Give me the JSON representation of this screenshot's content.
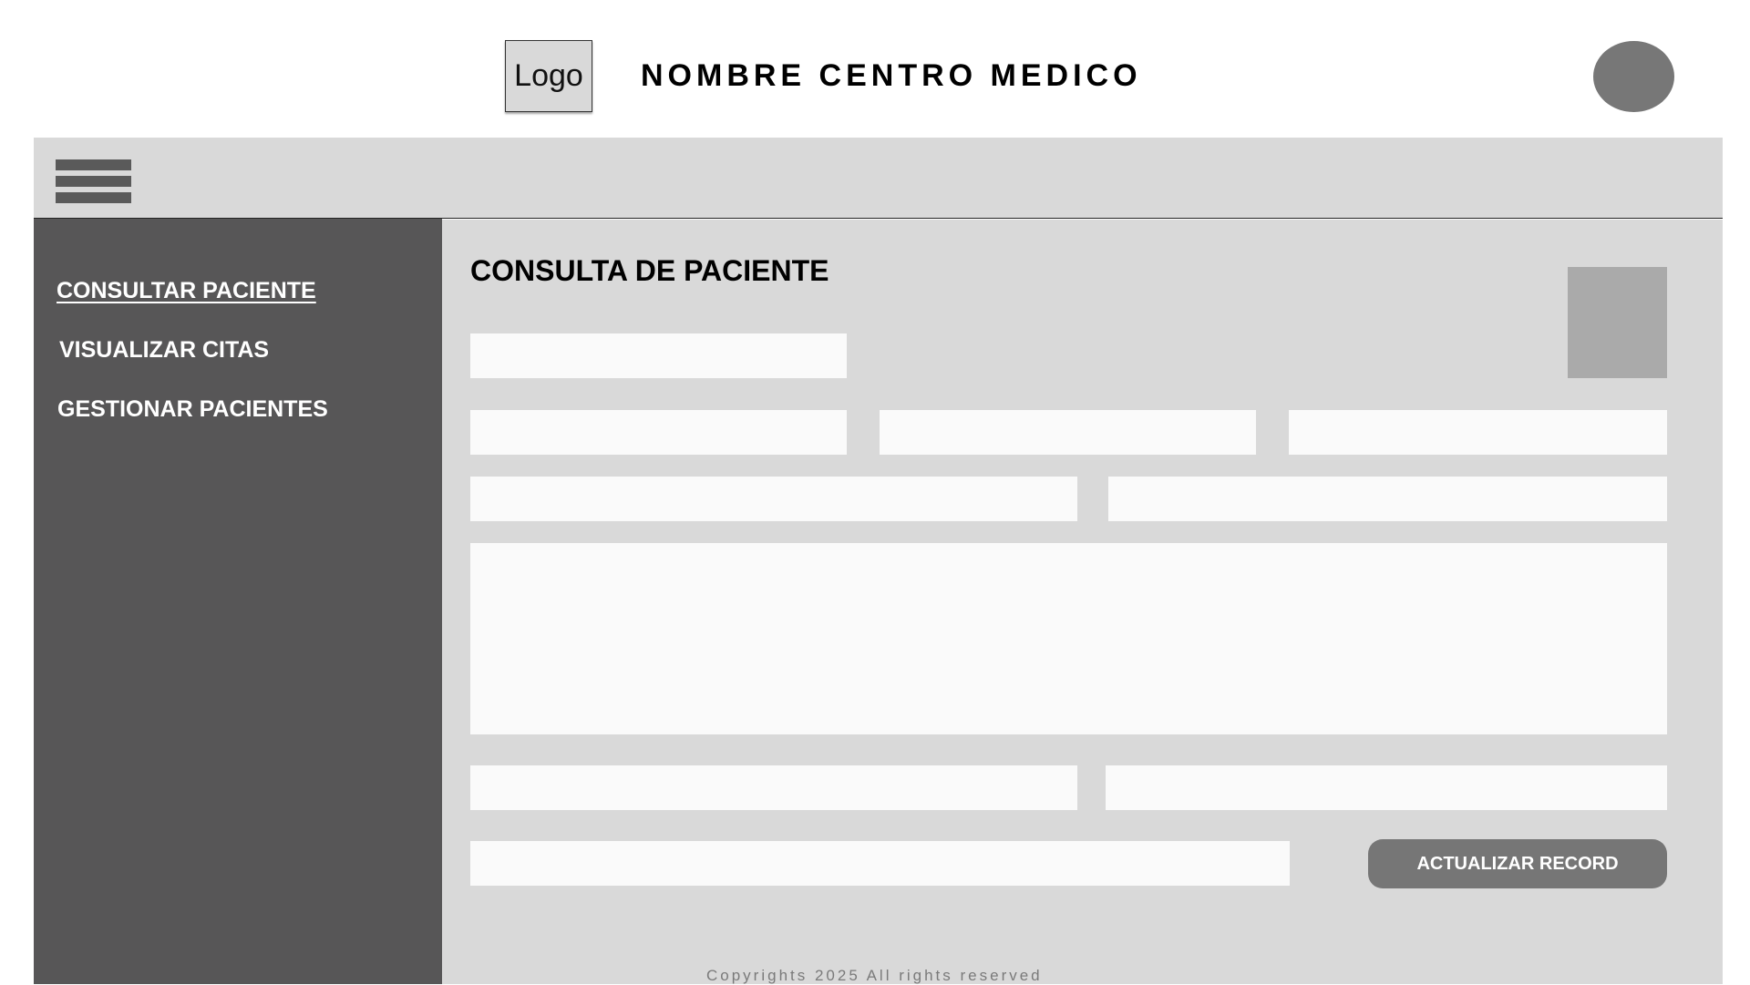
{
  "header": {
    "logo_text": "Logo",
    "center_name": "NOMBRE CENTRO MEDICO"
  },
  "sidebar": {
    "items": [
      {
        "label": "CONSULTAR PACIENTE",
        "active": true
      },
      {
        "label": "VISUALIZAR CITAS",
        "active": false
      },
      {
        "label": "GESTIONAR PACIENTES",
        "active": false
      }
    ]
  },
  "main": {
    "title": "CONSULTA DE PACIENTE",
    "fields": [
      {
        "value": "",
        "placeholder": ""
      },
      {
        "value": "",
        "placeholder": ""
      },
      {
        "value": "",
        "placeholder": ""
      },
      {
        "value": "",
        "placeholder": ""
      },
      {
        "value": "",
        "placeholder": ""
      },
      {
        "value": "",
        "placeholder": ""
      },
      {
        "value": "",
        "placeholder": ""
      },
      {
        "value": "",
        "placeholder": ""
      },
      {
        "value": "",
        "placeholder": ""
      },
      {
        "value": "",
        "placeholder": ""
      }
    ],
    "update_button_label": "ACTUALIZAR RECORD"
  },
  "footer": {
    "text": "Copyrights 2025 All rights reserved"
  },
  "icons": {
    "menu": "hamburger-menu-icon",
    "avatar": "user-avatar"
  },
  "colors": {
    "sidebar": "#575657",
    "panel": "#d9d9d9",
    "button": "#767676",
    "field": "#fafafa"
  }
}
